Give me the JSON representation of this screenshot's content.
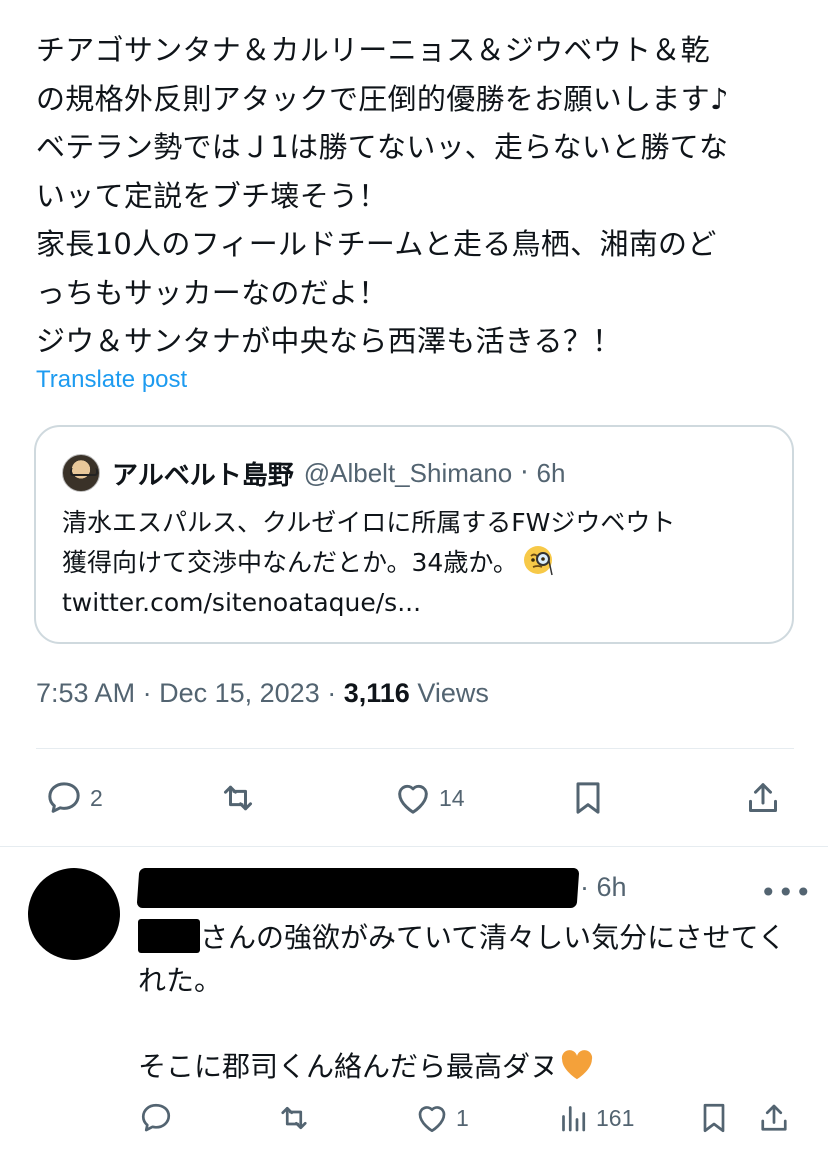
{
  "post": {
    "lines": [
      "チアゴサンタナ＆カルリーニョス＆ジウベウト＆乾",
      "の規格外反則アタックで圧倒的優勝をお願いします♪",
      "ベテラン勢ではＪ1は勝てないッ、走らないと勝てな",
      "いッて定説をブチ壊そう！",
      "家長10人のフィールドチームと走る鳥栖、湘南のど",
      "っちもサッカーなのだよ！",
      "ジウ＆サンタナが中央なら西澤も活きる？！"
    ],
    "translate_label": "Translate post"
  },
  "quote": {
    "display_name": "アルベルト島野",
    "handle": "@Albelt_Shimano",
    "separator": "·",
    "time": "6h",
    "lines": [
      "清水エスパルス、クルゼイロに所属するFWジウベウト",
      "獲得向けて交渉中なんだとか。34歳か。",
      "twitter.com/sitenoataque/s..."
    ]
  },
  "meta": {
    "time": "7:53 AM",
    "sep1": "·",
    "date": "Dec 15, 2023",
    "sep2": "·",
    "views_count": "3,116",
    "views_label": "Views"
  },
  "actions": {
    "reply_count": "2",
    "retweet_count": "",
    "like_count": "14"
  },
  "reply": {
    "time": "· 6h",
    "more": "•••",
    "line1_suffix": "さんの強欲がみていて清々しい気分にさせてく",
    "line2": "れた。",
    "line3": "",
    "line4": "そこに郡司くん絡んだら最高ダヌ",
    "reply_count": "",
    "retweet_count": "",
    "like_count": "1",
    "views_count": "161"
  },
  "colors": {
    "accent": "#1d9bf0",
    "muted": "#536471",
    "text": "#0f1419",
    "border": "#cfd9de",
    "heart_emoji": "#f4a13a"
  }
}
